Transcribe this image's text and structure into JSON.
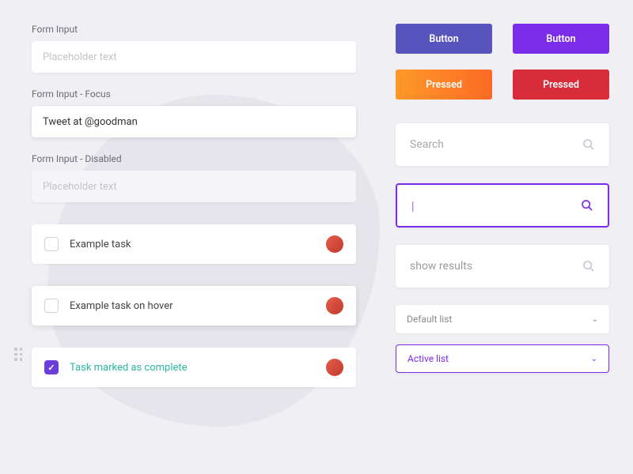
{
  "inputs": {
    "default_label": "Form Input",
    "default_placeholder": "Placeholder text",
    "focus_label": "Form Input - Focus",
    "focus_value": "Tweet at @goodman",
    "disabled_label": "Form Input - Disabled",
    "disabled_placeholder": "Placeholder text"
  },
  "tasks": {
    "default_text": "Example task",
    "hover_text": "Example task on hover",
    "complete_text": "Task marked as complete"
  },
  "buttons": {
    "primary": "Button",
    "secondary": "Button",
    "pressed1": "Pressed",
    "pressed2": "Pressed"
  },
  "search": {
    "placeholder": "Search",
    "focus_value": "|",
    "results_text": "show results"
  },
  "selects": {
    "default": "Default list",
    "active": "Active list"
  }
}
